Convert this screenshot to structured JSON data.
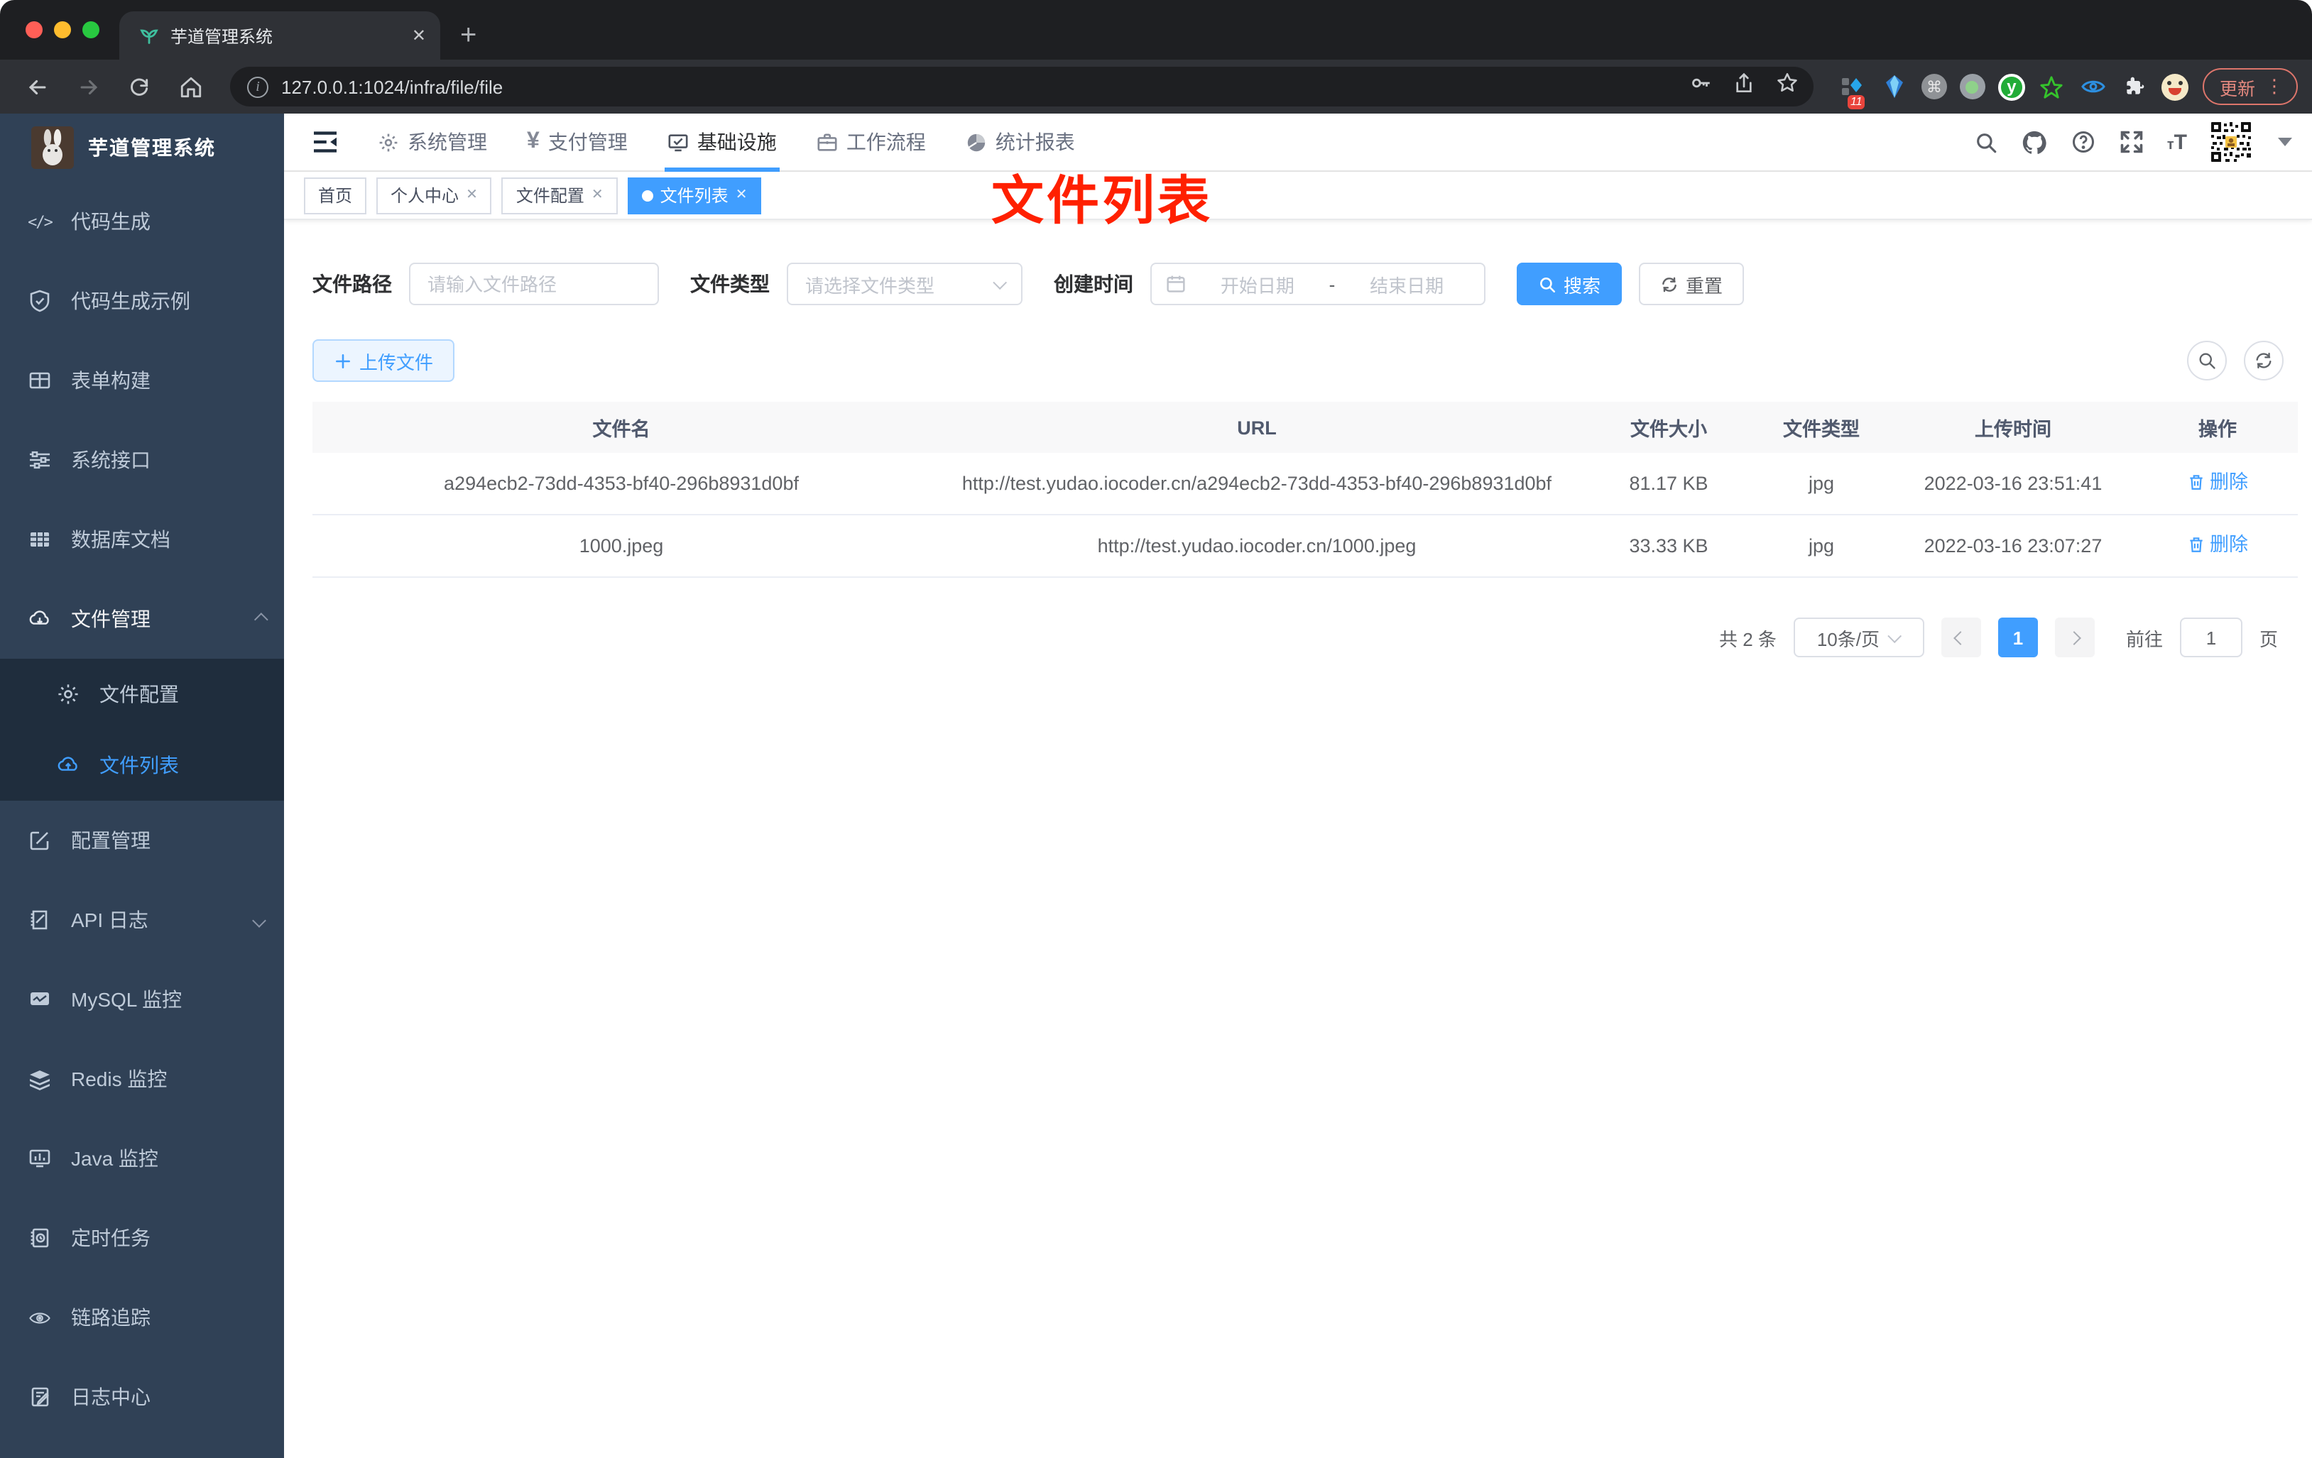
{
  "browser": {
    "tab_title": "芋道管理系统",
    "url": "127.0.0.1:1024/infra/file/file",
    "update_label": "更新",
    "extension_badge": "11"
  },
  "icons": {
    "close": "✕",
    "new_tab": "+",
    "command": "⌘",
    "yen": "¥",
    "y_ext": "y",
    "dots": "⋮",
    "info": "i",
    "font_size_small": "т",
    "font_size_big": "T",
    "code": "</>"
  },
  "app_header": {
    "menus": [
      {
        "label": "系统管理",
        "active": false
      },
      {
        "label": "支付管理",
        "active": false
      },
      {
        "label": "基础设施",
        "active": true
      },
      {
        "label": "工作流程",
        "active": false
      },
      {
        "label": "统计报表",
        "active": false
      }
    ]
  },
  "tags": [
    {
      "label": "首页",
      "closable": false,
      "active": false
    },
    {
      "label": "个人中心",
      "closable": true,
      "active": false
    },
    {
      "label": "文件配置",
      "closable": true,
      "active": false
    },
    {
      "label": "文件列表",
      "closable": true,
      "active": true
    }
  ],
  "annotation": {
    "text": "文件列表",
    "color": "#ff2000"
  },
  "sidebar": {
    "title": "芋道管理系统",
    "items": [
      {
        "label": "代码生成"
      },
      {
        "label": "代码生成示例"
      },
      {
        "label": "表单构建"
      },
      {
        "label": "系统接口"
      },
      {
        "label": "数据库文档"
      },
      {
        "label": "文件管理",
        "expanded": true,
        "children": [
          {
            "label": "文件配置",
            "active": false
          },
          {
            "label": "文件列表",
            "active": true
          }
        ]
      },
      {
        "label": "配置管理"
      },
      {
        "label": "API 日志",
        "has_children": true
      },
      {
        "label": "MySQL 监控"
      },
      {
        "label": "Redis 监控"
      },
      {
        "label": "Java 监控"
      },
      {
        "label": "定时任务"
      },
      {
        "label": "链路追踪"
      },
      {
        "label": "日志中心"
      }
    ]
  },
  "filters": {
    "path_label": "文件路径",
    "path_placeholder": "请输入文件路径",
    "type_label": "文件类型",
    "type_placeholder": "请选择文件类型",
    "time_label": "创建时间",
    "start_placeholder": "开始日期",
    "range_separator": "-",
    "end_placeholder": "结束日期",
    "search_label": "搜索",
    "reset_label": "重置"
  },
  "toolbar": {
    "upload_label": "上传文件"
  },
  "table": {
    "headers": [
      "文件名",
      "URL",
      "文件大小",
      "文件类型",
      "上传时间",
      "操作"
    ],
    "rows": [
      {
        "name": "a294ecb2-73dd-4353-bf40-296b8931d0bf",
        "url": "http://test.yudao.iocoder.cn/a294ecb2-73dd-4353-bf40-296b8931d0bf",
        "size": "81.17 KB",
        "type": "jpg",
        "time": "2022-03-16 23:51:41",
        "action": "删除"
      },
      {
        "name": "1000.jpeg",
        "url": "http://test.yudao.iocoder.cn/1000.jpeg",
        "size": "33.33 KB",
        "type": "jpg",
        "time": "2022-03-16 23:07:27",
        "action": "删除"
      }
    ]
  },
  "pagination": {
    "total": "共 2 条",
    "page_size": "10条/页",
    "current_page": "1",
    "goto_label": "前往",
    "goto_value": "1",
    "page_unit": "页"
  },
  "colors": {
    "accent": "#409eff",
    "sidebar_bg": "#304156",
    "sidebar_sub_bg": "#1f2d3d",
    "annotation_red": "#ff2000"
  }
}
